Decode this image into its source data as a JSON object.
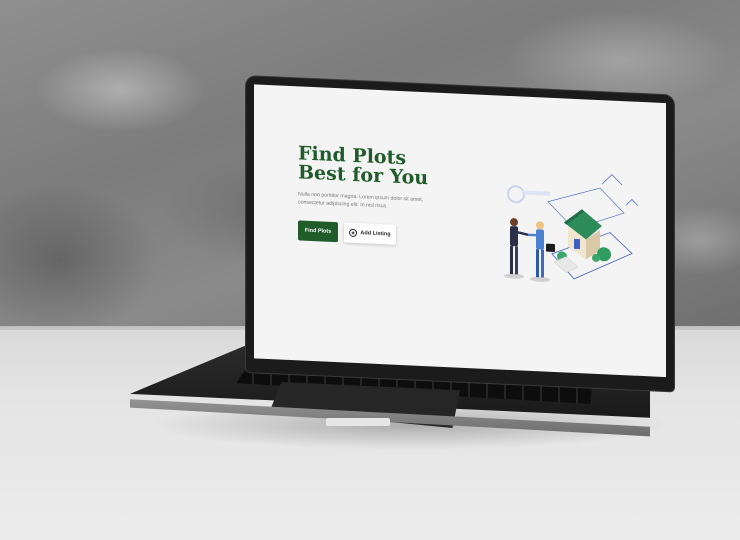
{
  "site": {
    "hero": {
      "title_line1": "Find Plots",
      "title_line2": "Best for You",
      "subtitle": "Nulla non porttitor magna. Lorem ipsum dolor sit amet, consectetur adipiscing elit. In nisl risus.",
      "primary_button": "Find Plots",
      "secondary_button": "Add Listing",
      "secondary_icon": "plus-circle-icon",
      "accent_color": "#1f5c2a"
    },
    "illustration": "house-handshake-illustration"
  }
}
